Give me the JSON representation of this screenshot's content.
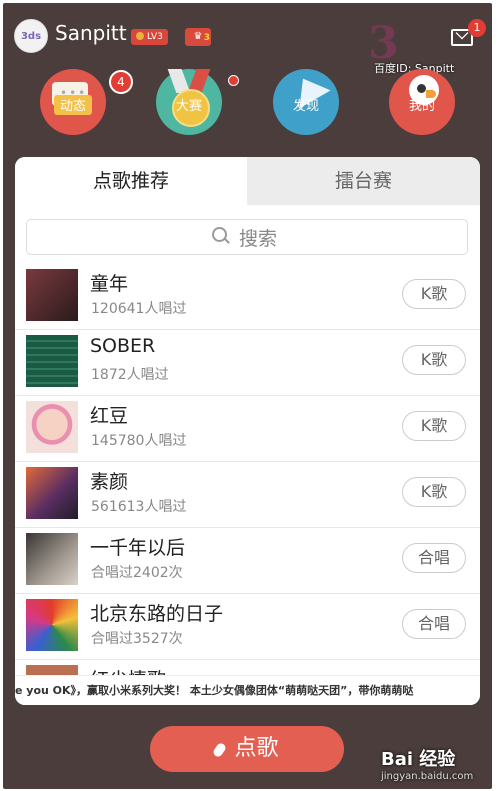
{
  "header": {
    "user_name": "Sanpitt",
    "avatar_text": "3ds",
    "level_badge": "LV3",
    "vip_level": "3",
    "mail_count": "1",
    "watermark_id": "百度ID: Sanpitt"
  },
  "nav": [
    {
      "label": "动态",
      "badge": "4"
    },
    {
      "label": "大赛"
    },
    {
      "label": "发现"
    },
    {
      "label": "我的"
    }
  ],
  "tabs": [
    {
      "label": "点歌推荐",
      "active": true
    },
    {
      "label": "擂台赛",
      "active": false
    }
  ],
  "search": {
    "placeholder": "搜索"
  },
  "songs": [
    {
      "title": "童年",
      "sub": "120641人唱过",
      "action": "K歌",
      "color": "#5a2a2e"
    },
    {
      "title": "SOBER",
      "sub": "1872人唱过",
      "action": "K歌",
      "color": "#1d5a44"
    },
    {
      "title": "红豆",
      "sub": "145780人唱过",
      "action": "K歌",
      "color": "#f2c9c6"
    },
    {
      "title": "素颜",
      "sub": "561613人唱过",
      "action": "K歌",
      "color": "#c74a35"
    },
    {
      "title": "一千年以后",
      "sub": "合唱过2402次",
      "action": "合唱",
      "color": "#6e6761"
    },
    {
      "title": "北京东路的日子",
      "sub": "合唱过3527次",
      "action": "合唱",
      "color": "#d5432e"
    },
    {
      "title": "红尘情歌",
      "sub": "",
      "action": "",
      "color": "#b86f52"
    }
  ],
  "ticker": "e you OK》，赢取小米系列大奖！    本土少女偶像团体“萌萌哒天团”，带你萌萌哒",
  "sing_button": "点歌",
  "brand_watermark": "Bai 经验",
  "brand_watermark_sub": "jingyan.baidu.com"
}
